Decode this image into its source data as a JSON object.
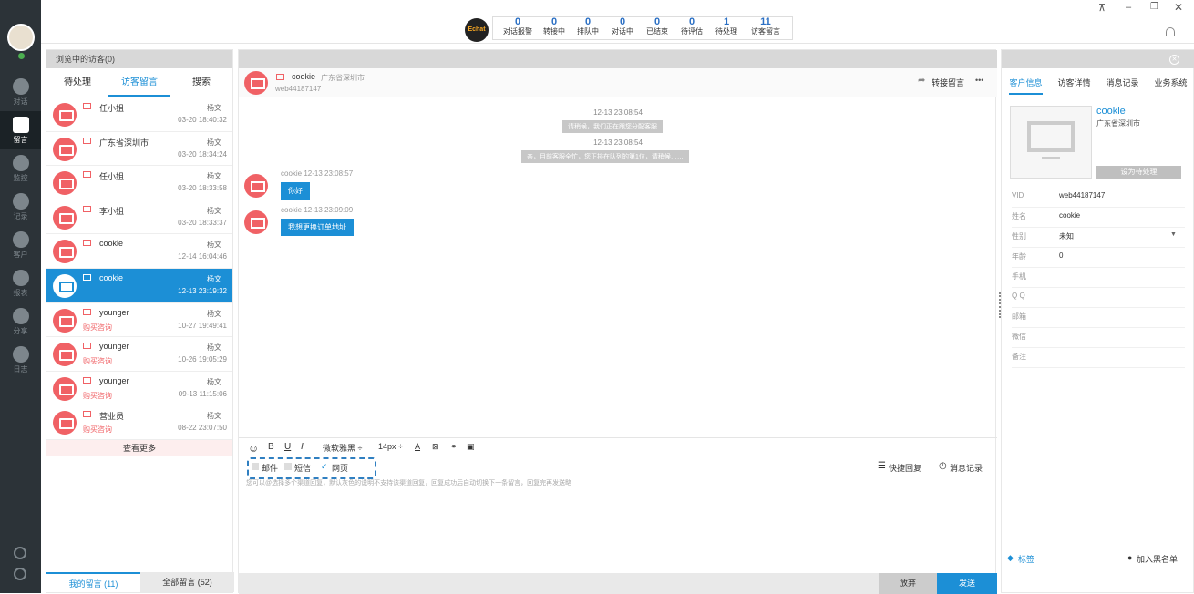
{
  "topbar": {
    "logo_text": "Echat",
    "stats": [
      {
        "n": "0",
        "label": "对话报警"
      },
      {
        "n": "0",
        "label": "转接中"
      },
      {
        "n": "0",
        "label": "排队中"
      },
      {
        "n": "0",
        "label": "对话中"
      },
      {
        "n": "0",
        "label": "已结束"
      },
      {
        "n": "0",
        "label": "待评估"
      },
      {
        "n": "1",
        "label": "待处理"
      },
      {
        "n": "11",
        "label": "访客留言"
      }
    ]
  },
  "nav": [
    "对话",
    "留言",
    "监控",
    "记录",
    "客户",
    "报表",
    "分享",
    "日志"
  ],
  "left": {
    "header": "浏览中的访客(0)",
    "tabs": [
      "待处理",
      "访客留言",
      "搜索"
    ],
    "messages": [
      {
        "name": "任小姐",
        "sub": "",
        "agent": "杨文",
        "time": "03-20 18:40:32"
      },
      {
        "name": "广东省深圳市",
        "sub": "",
        "agent": "杨文",
        "time": "03-20 18:34:24"
      },
      {
        "name": "任小姐",
        "sub": "",
        "agent": "杨文",
        "time": "03-20 18:33:58"
      },
      {
        "name": "李小姐",
        "sub": "",
        "agent": "杨文",
        "time": "03-20 18:33:37"
      },
      {
        "name": "cookie",
        "sub": "",
        "agent": "杨文",
        "time": "12-14 16:04:46"
      },
      {
        "name": "cookie",
        "sub": "",
        "agent": "杨文",
        "time": "12-13 23:19:32"
      },
      {
        "name": "younger",
        "sub": "购买咨询",
        "agent": "杨文",
        "time": "10-27 19:49:41"
      },
      {
        "name": "younger",
        "sub": "购买咨询",
        "agent": "杨文",
        "time": "10-26 19:05:29"
      },
      {
        "name": "younger",
        "sub": "购买咨询",
        "agent": "杨文",
        "time": "09-13 11:15:06"
      },
      {
        "name": "营业员",
        "sub": "购买咨询",
        "agent": "杨文",
        "time": "08-22 23:07:50"
      }
    ],
    "more": "查看更多",
    "bottom_tabs": [
      "我的留言 (11)",
      "全部留言 (52)"
    ]
  },
  "center": {
    "visitor": "cookie",
    "location": "广东省深圳市",
    "vid": "web44187147",
    "transfer": "转接留言",
    "dots": "•••",
    "chat": {
      "t1": "12-13 23:08:54",
      "s1": "请稍候，我们正在跟您分配客服",
      "t2": "12-13 23:08:54",
      "s2": "亲，目前客服全忙，您正排在队列的第1位，请稍候……",
      "m1_meta": "cookie 12-13 23:08:57",
      "m1": "你好",
      "m2_meta": "cookie 12-13 23:09:09",
      "m2": "我想更换订单地址"
    },
    "toolbar": {
      "bold": "B",
      "underline": "U",
      "italic": "I",
      "font": "微软雅黑 ÷",
      "size": "14px ÷",
      "color": "A"
    },
    "channels": {
      "mail": "邮件",
      "sms": "短信",
      "web": "网页"
    },
    "quick_reply": "快捷回复",
    "history": "消息记录",
    "hint": "您可以@选择多个渠道回复，默认灰色的说明不支持该渠道回复，回复成功后自动切换下一条留言，回复完再发送略",
    "discard": "放弃",
    "send": "发送"
  },
  "right": {
    "tabs": [
      "客户信息",
      "访客详情",
      "消息记录",
      "业务系统"
    ],
    "name": "cookie",
    "location": "广东省深圳市",
    "set_pending": "设为待处理",
    "fields": [
      {
        "k": "VID",
        "v": "web44187147"
      },
      {
        "k": "姓名",
        "v": "cookie"
      },
      {
        "k": "性别",
        "v": "未知"
      },
      {
        "k": "年龄",
        "v": "0"
      },
      {
        "k": "手机",
        "v": ""
      },
      {
        "k": "Q Q",
        "v": ""
      },
      {
        "k": "邮箱",
        "v": ""
      },
      {
        "k": "微信",
        "v": ""
      },
      {
        "k": "备注",
        "v": ""
      }
    ],
    "tag": "标签",
    "blacklist": "加入黑名单"
  }
}
